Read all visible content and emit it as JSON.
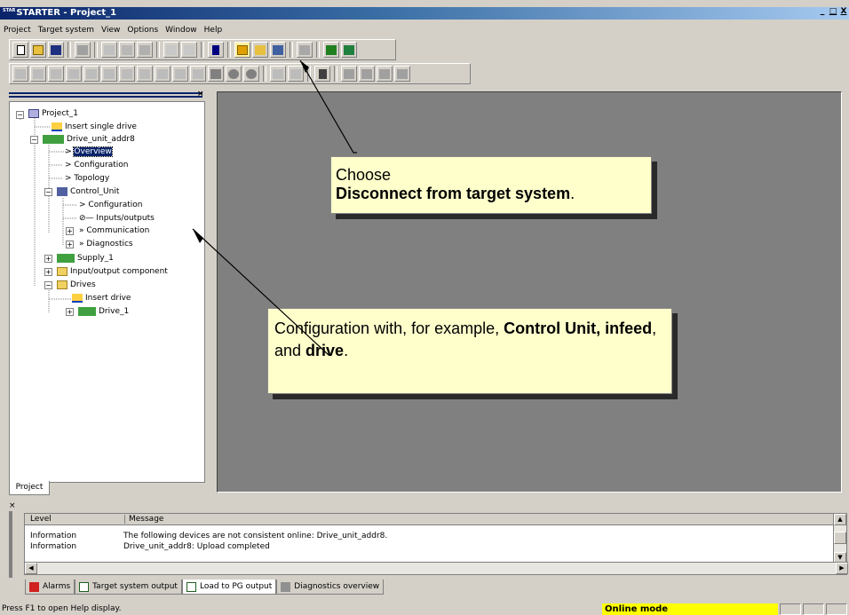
{
  "window": {
    "title": "STARTER - Project_1",
    "logo_text": "STAR",
    "controls": [
      "_",
      "Ő",
      "X"
    ]
  },
  "menu": [
    "Project",
    "Target system",
    "View",
    "Options",
    "Window",
    "Help"
  ],
  "project_panel": {
    "tab_label": "Project",
    "tree": {
      "root": "Project_1",
      "insert_single_drive": "Insert single drive",
      "drive_unit": "Drive_unit_addr8",
      "overview": "Overview",
      "configuration": "Configuration",
      "topology": "Topology",
      "control_unit": "Control_Unit",
      "cu_configuration": "Configuration",
      "inputs_outputs": "Inputs/outputs",
      "communication": "Communication",
      "diagnostics": "Diagnostics",
      "supply": "Supply_1",
      "io_component": "Input/output component",
      "drives": "Drives",
      "insert_drive": "Insert drive",
      "drive_1": "Drive_1"
    }
  },
  "callouts": {
    "disconnect": {
      "line1": "Choose",
      "line2_bold": "Disconnect from target system",
      "line2_end": "."
    },
    "configuration": {
      "text_a": "Configuration with, for example, ",
      "bold_a": "Control Unit, infeed",
      "text_b": ", and ",
      "bold_b": "drive",
      "text_c": "."
    }
  },
  "output": {
    "columns": [
      "Level",
      "Message"
    ],
    "rows": [
      {
        "level": "Information",
        "message": "The following devices are not consistent online: Drive_unit_addr8."
      },
      {
        "level": "Information",
        "message": "Drive_unit_addr8: Upload completed"
      }
    ],
    "tabs": [
      "Alarms",
      "Target system output",
      "Load to PG output",
      "Diagnostics overview"
    ]
  },
  "status": {
    "help": "Press F1 to open Help display.",
    "mode": "Online mode"
  },
  "colors": {
    "title_start": "#0a246a",
    "callout_bg": "#ffffcc",
    "workspace_bg": "#808080",
    "online_mode_bg": "#ffff00"
  }
}
